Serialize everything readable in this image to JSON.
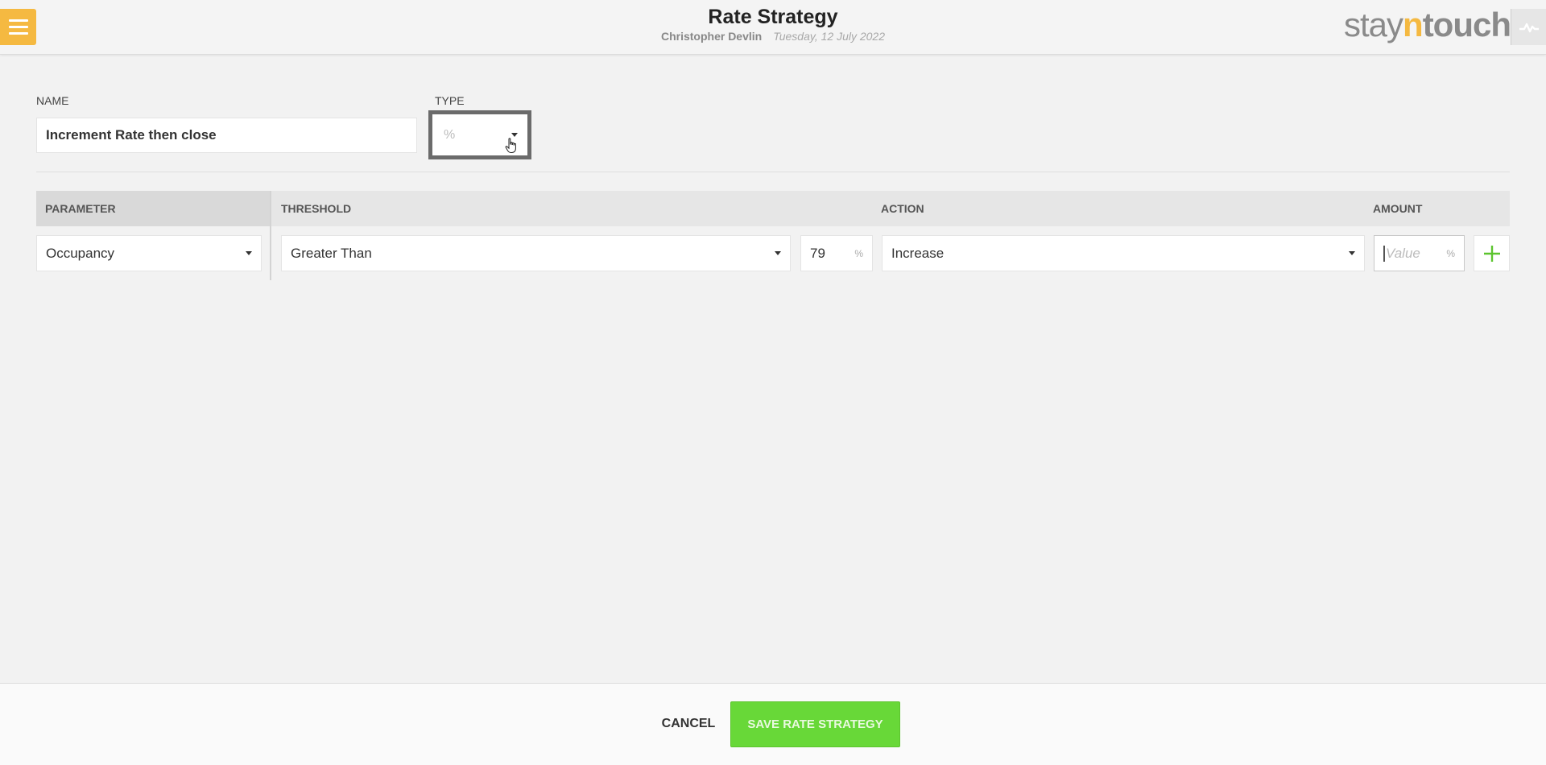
{
  "header": {
    "title": "Rate Strategy",
    "user": "Christopher Devlin",
    "date": "Tuesday, 12 July 2022",
    "logo": {
      "part1": "stay",
      "part2": "n",
      "part3": "touch"
    },
    "menu_icon": "hamburger-icon",
    "status_icon": "activity-icon"
  },
  "form": {
    "name_label": "NAME",
    "name_value": "Increment Rate then close",
    "type_label": "TYPE",
    "type_value": "%"
  },
  "table": {
    "headers": {
      "parameter": "PARAMETER",
      "threshold": "THRESHOLD",
      "action": "ACTION",
      "amount": "AMOUNT"
    },
    "row": {
      "parameter": "Occupancy",
      "threshold_operator": "Greater Than",
      "threshold_value": "79",
      "threshold_unit": "%",
      "action": "Increase",
      "amount_placeholder": "Value",
      "amount_unit": "%"
    },
    "add_icon": "plus-icon"
  },
  "footer": {
    "cancel_label": "CANCEL",
    "save_label": "SAVE RATE STRATEGY"
  },
  "colors": {
    "menu": "#f5b941",
    "save": "#68d838",
    "add": "#5cc42e",
    "logo_accent": "#f5b941"
  }
}
